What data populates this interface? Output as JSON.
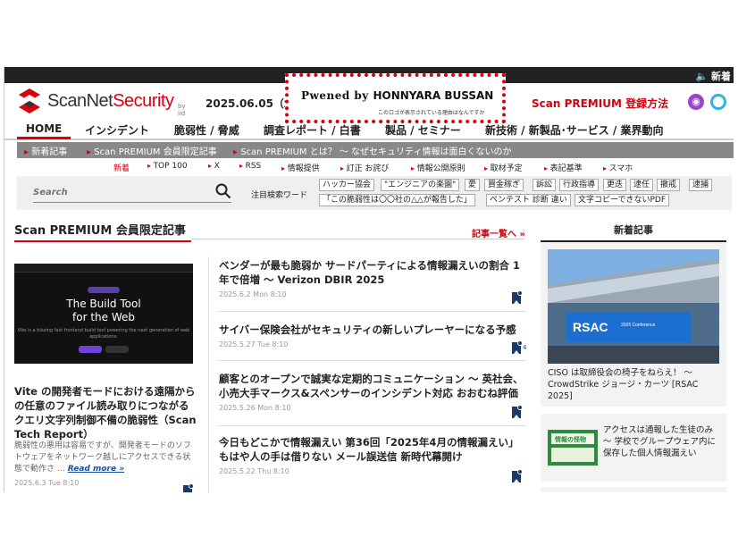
{
  "topbar": {
    "new_label": "🔈 新着"
  },
  "header": {
    "logo_text_a": "ScanNet",
    "logo_text_b": "Security",
    "logo_by": "by iid",
    "date": "2025.06.05（木）",
    "ad_main_prefix": "Pwened by ",
    "ad_main_brand": "HONNYARA BUSSAN",
    "ad_sub": "このロゴが表示されている理由はなんですか",
    "premium_register": "Scan PREMIUM 登録方法"
  },
  "nav": {
    "items": [
      "HOME",
      "インシデント",
      "脆弱性 / 脅威",
      "調査レポート / 白書",
      "製品 / セミナー",
      "新技術 / 新製品･サービス / 業界動向"
    ]
  },
  "redbar": {
    "items": [
      "新着記事",
      "Scan PREMIUM 会員限定記事",
      "Scan PREMIUM とは？ ～ なぜセキュリティ情報は面白くないのか"
    ]
  },
  "subnav": {
    "items": [
      "新着",
      "TOP 100",
      "X",
      "RSS",
      "情報提供",
      "訂正 お詫び",
      "情報公開原則",
      "取材予定",
      "表記基準",
      "スマホ"
    ]
  },
  "search": {
    "placeholder": "Search",
    "keyword_label": "注目検索ワード",
    "tags_row1": [
      "ハッカー協会",
      "\"エンジニアの楽園\"",
      "愛",
      "買金稼ぎ",
      "訴訟",
      "行政指導",
      "更迭",
      "逮任",
      "撤戒",
      "逮捕"
    ],
    "tags_row2": [
      "「この脆弱性は〇〇社の△△が報告した」",
      "ペンテスト 診断 違い",
      "文字コピーできないPDF"
    ]
  },
  "premium_section": {
    "title": "Scan PREMIUM 会員限定記事",
    "more": "記事一覧へ »"
  },
  "feature": {
    "img_title_line1": "The Build Tool",
    "img_title_line2": "for the Web",
    "img_desc": "Vite is a blazing fast frontend build tool powering the next generation of web applications.",
    "title": "Vite の開発者モードにおける遠隔からの任意のファイル読み取りにつながるクエリ文字列制御不備の脆弱性（Scan Tech Report）",
    "desc": "脆弱性の悪用は容易ですが、開発者モードのソフトウェアをネットワーク越しにアクセスできる状態で動作さ …",
    "read_more": "Read more »",
    "date": "2025.6.3 Tue 8:10"
  },
  "articles": [
    {
      "title": "ベンダーが最も脆弱か サードパーティによる情報漏えいの割合 1 年で倍増 ～ Verizon DBIR 2025",
      "date": "2025.6.2 Mon 8:10",
      "count": ""
    },
    {
      "title": "サイバー保険会社がセキュリティの新しいプレーヤーになる予感",
      "date": "2025.5.27 Tue 8:10",
      "count": "4"
    },
    {
      "title": "顧客とのオープンで誠実な定期的コミュニケーション ～ 英社会、小売大手マークス&スペンサーのインシデント対応 おおむね評価",
      "date": "2025.5.26 Mon 8:10",
      "count": ""
    },
    {
      "title": "今日もどこかで情報漏えい 第36回「2025年4月の情報漏えい」もはや人の手は借りない メール誤送信 新時代幕開け",
      "date": "2025.5.22 Thu 8:10",
      "count": ""
    }
  ],
  "sidebar": {
    "title": "新着記事",
    "item1_img_text": "RSAC",
    "item1_img_sub": "2025 Conference",
    "item1": "CISO は取締役会の椅子をねらえ！ ～ CrowdStrike ジョージ・カーツ [RSAC 2025]",
    "item2_img_text": "情報の怪物",
    "item2": "アクセスは通報した生徒のみ ～ 学校でグループウェア内に保存した個人情報漏えい"
  },
  "colors": {
    "brand_red": "#d8000f",
    "navy": "#1a3a6b"
  }
}
